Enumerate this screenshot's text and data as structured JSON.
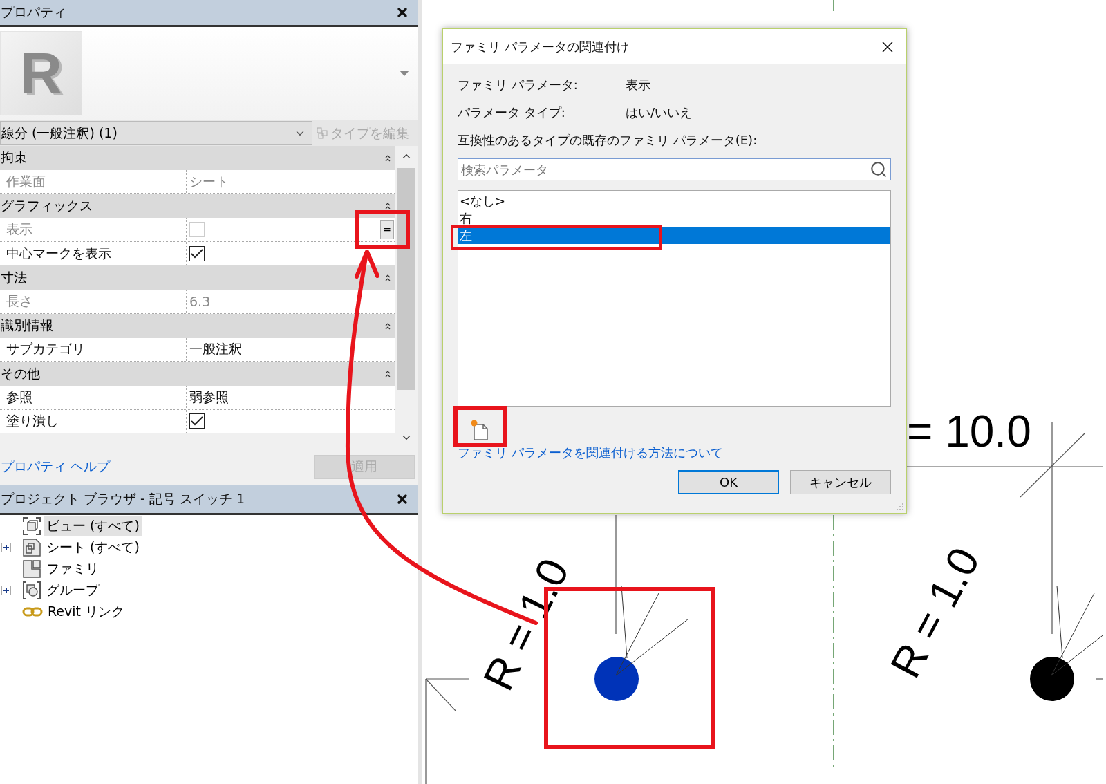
{
  "properties": {
    "title": "プロパティ",
    "preview_logo": "R",
    "type_selector": "線分 (一般注釈) (1)",
    "edit_type": {
      "label": "タイプを編集",
      "disabled": true
    },
    "groups": [
      {
        "name": "拘束",
        "expanded": true,
        "rows": [
          {
            "name": "作業面",
            "kind": "text",
            "value": "シート",
            "disabled": true
          }
        ]
      },
      {
        "name": "グラフィックス",
        "expanded": true,
        "rows": [
          {
            "name": "表示",
            "kind": "checkbox",
            "checked": false,
            "disabled": true,
            "associate": "="
          },
          {
            "name": "中心マークを表示",
            "kind": "checkbox",
            "checked": true,
            "disabled": false
          }
        ]
      },
      {
        "name": "寸法",
        "expanded": true,
        "rows": [
          {
            "name": "長さ",
            "kind": "text",
            "value": "6.3",
            "disabled": true
          }
        ]
      },
      {
        "name": "識別情報",
        "expanded": true,
        "rows": [
          {
            "name": "サブカテゴリ",
            "kind": "text",
            "value": "一般注釈",
            "disabled": false
          }
        ]
      },
      {
        "name": "その他",
        "expanded": true,
        "rows": [
          {
            "name": "参照",
            "kind": "text",
            "value": "弱参照",
            "disabled": false
          },
          {
            "name": "塗り潰し",
            "kind": "checkbox",
            "checked": true,
            "disabled": false
          }
        ]
      }
    ],
    "help_link": "プロパティ ヘルプ",
    "apply": {
      "label": "適用",
      "disabled": true
    }
  },
  "project_browser": {
    "title": "プロジェクト ブラウザ - 記号 スイッチ 1",
    "items": [
      {
        "label": "ビュー (すべて)",
        "kind": "view",
        "expandable": false,
        "selected": true
      },
      {
        "label": "シート (すべて)",
        "kind": "sheet",
        "expandable": true,
        "selected": false
      },
      {
        "label": "ファミリ",
        "kind": "family",
        "expandable": false,
        "selected": false
      },
      {
        "label": "グループ",
        "kind": "group",
        "expandable": true,
        "selected": false
      },
      {
        "label": "Revit リンク",
        "kind": "link",
        "expandable": false,
        "selected": false
      }
    ]
  },
  "dialog": {
    "title": "ファミリ パラメータの関連付け",
    "fields": [
      {
        "label": "ファミリ パラメータ:",
        "value": "表示"
      },
      {
        "label": "パラメータ タイプ:",
        "value": "はい/いいえ"
      }
    ],
    "list_label": "互換性のあるタイプの既存のファミリ パラメータ(E):",
    "search": {
      "placeholder": "検索パラメータ"
    },
    "items": [
      {
        "label": "<なし>",
        "selected": false
      },
      {
        "label": "右",
        "selected": false
      },
      {
        "label": "左",
        "selected": true
      }
    ],
    "help_link": "ファミリ パラメータを関連付ける方法について",
    "buttons": [
      {
        "label": "OK",
        "default": true
      },
      {
        "label": "キャンセル",
        "default": false
      }
    ]
  },
  "canvas": {
    "dimension_label": "= 10.0",
    "radius_labels": [
      "R = 1.0",
      "R = 1.0"
    ],
    "markers": [
      {
        "color": "#0033b8"
      },
      {
        "color": "#000000"
      }
    ]
  }
}
